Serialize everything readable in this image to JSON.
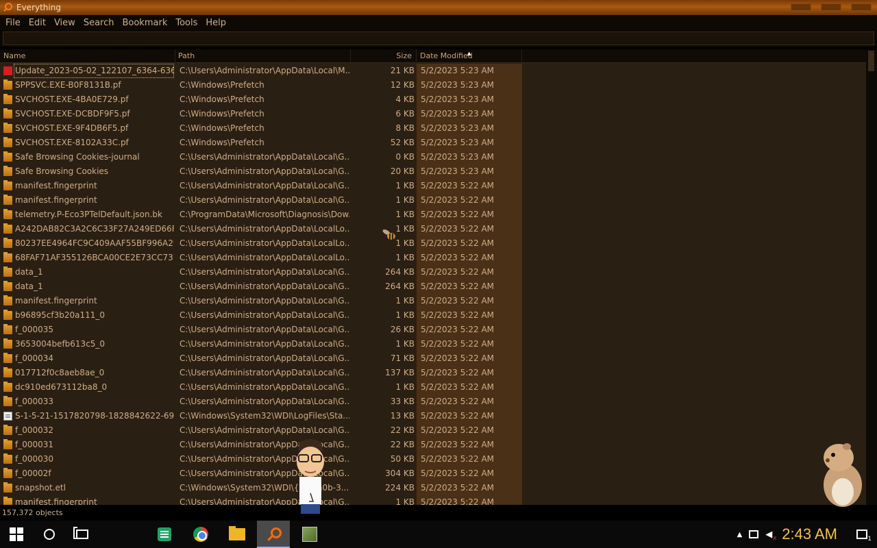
{
  "window": {
    "title": "Everything"
  },
  "menu": [
    "File",
    "Edit",
    "View",
    "Search",
    "Bookmark",
    "Tools",
    "Help"
  ],
  "search": {
    "value": ""
  },
  "columns": {
    "name": "Name",
    "path": "Path",
    "size": "Size",
    "date": "Date Modified",
    "sort_indicator": "▲"
  },
  "rows": [
    {
      "icon": "red-file-icon",
      "name": "Update_2023-05-02_122107_6364-636...",
      "path": "C:\\Users\\Administrator\\AppData\\Local\\M...",
      "size": "21 KB",
      "date": "5/2/2023 5:23 AM",
      "selected": true
    },
    {
      "icon": "folder-icon",
      "name": "SPPSVC.EXE-B0F8131B.pf",
      "path": "C:\\Windows\\Prefetch",
      "size": "12 KB",
      "date": "5/2/2023 5:23 AM"
    },
    {
      "icon": "folder-icon",
      "name": "SVCHOST.EXE-4BA0E729.pf",
      "path": "C:\\Windows\\Prefetch",
      "size": "4 KB",
      "date": "5/2/2023 5:23 AM"
    },
    {
      "icon": "folder-icon",
      "name": "SVCHOST.EXE-DCBDF9F5.pf",
      "path": "C:\\Windows\\Prefetch",
      "size": "6 KB",
      "date": "5/2/2023 5:23 AM"
    },
    {
      "icon": "folder-icon",
      "name": "SVCHOST.EXE-9F4DB6F5.pf",
      "path": "C:\\Windows\\Prefetch",
      "size": "8 KB",
      "date": "5/2/2023 5:23 AM"
    },
    {
      "icon": "folder-icon",
      "name": "SVCHOST.EXE-8102A33C.pf",
      "path": "C:\\Windows\\Prefetch",
      "size": "52 KB",
      "date": "5/2/2023 5:23 AM"
    },
    {
      "icon": "folder-icon",
      "name": "Safe Browsing Cookies-journal",
      "path": "C:\\Users\\Administrator\\AppData\\Local\\G...",
      "size": "0 KB",
      "date": "5/2/2023 5:23 AM"
    },
    {
      "icon": "folder-icon",
      "name": "Safe Browsing Cookies",
      "path": "C:\\Users\\Administrator\\AppData\\Local\\G...",
      "size": "20 KB",
      "date": "5/2/2023 5:23 AM"
    },
    {
      "icon": "folder-icon",
      "name": "manifest.fingerprint",
      "path": "C:\\Users\\Administrator\\AppData\\Local\\G...",
      "size": "1 KB",
      "date": "5/2/2023 5:22 AM"
    },
    {
      "icon": "folder-icon",
      "name": "manifest.fingerprint",
      "path": "C:\\Users\\Administrator\\AppData\\Local\\G...",
      "size": "1 KB",
      "date": "5/2/2023 5:22 AM"
    },
    {
      "icon": "folder-icon",
      "name": "telemetry.P-Eco3PTelDefault.json.bk",
      "path": "C:\\ProgramData\\Microsoft\\Diagnosis\\Dow...",
      "size": "1 KB",
      "date": "5/2/2023 5:22 AM"
    },
    {
      "icon": "folder-icon",
      "name": "A242DAB82C3A2C6C33F27A249ED66F...",
      "path": "C:\\Users\\Administrator\\AppData\\LocalLo...",
      "size": "1 KB",
      "date": "5/2/2023 5:22 AM"
    },
    {
      "icon": "folder-icon",
      "name": "80237EE4964FC9C409AAF55BF996A29...",
      "path": "C:\\Users\\Administrator\\AppData\\LocalLo...",
      "size": "1 KB",
      "date": "5/2/2023 5:22 AM"
    },
    {
      "icon": "folder-icon",
      "name": "68FAF71AF355126BCA00CE2E73CC737...",
      "path": "C:\\Users\\Administrator\\AppData\\LocalLo...",
      "size": "1 KB",
      "date": "5/2/2023 5:22 AM"
    },
    {
      "icon": "folder-icon",
      "name": "data_1",
      "path": "C:\\Users\\Administrator\\AppData\\Local\\G...",
      "size": "264 KB",
      "date": "5/2/2023 5:22 AM"
    },
    {
      "icon": "folder-icon",
      "name": "data_1",
      "path": "C:\\Users\\Administrator\\AppData\\Local\\G...",
      "size": "264 KB",
      "date": "5/2/2023 5:22 AM"
    },
    {
      "icon": "folder-icon",
      "name": "manifest.fingerprint",
      "path": "C:\\Users\\Administrator\\AppData\\Local\\G...",
      "size": "1 KB",
      "date": "5/2/2023 5:22 AM"
    },
    {
      "icon": "folder-icon",
      "name": "b96895cf3b20a111_0",
      "path": "C:\\Users\\Administrator\\AppData\\Local\\G...",
      "size": "1 KB",
      "date": "5/2/2023 5:22 AM"
    },
    {
      "icon": "folder-icon",
      "name": "f_000035",
      "path": "C:\\Users\\Administrator\\AppData\\Local\\G...",
      "size": "26 KB",
      "date": "5/2/2023 5:22 AM"
    },
    {
      "icon": "folder-icon",
      "name": "3653004befb613c5_0",
      "path": "C:\\Users\\Administrator\\AppData\\Local\\G...",
      "size": "1 KB",
      "date": "5/2/2023 5:22 AM"
    },
    {
      "icon": "folder-icon",
      "name": "f_000034",
      "path": "C:\\Users\\Administrator\\AppData\\Local\\G...",
      "size": "71 KB",
      "date": "5/2/2023 5:22 AM"
    },
    {
      "icon": "folder-icon",
      "name": "017712f0c8aeb8ae_0",
      "path": "C:\\Users\\Administrator\\AppData\\Local\\G...",
      "size": "137 KB",
      "date": "5/2/2023 5:22 AM"
    },
    {
      "icon": "folder-icon",
      "name": "dc910ed673112ba8_0",
      "path": "C:\\Users\\Administrator\\AppData\\Local\\G...",
      "size": "1 KB",
      "date": "5/2/2023 5:22 AM"
    },
    {
      "icon": "folder-icon",
      "name": "f_000033",
      "path": "C:\\Users\\Administrator\\AppData\\Local\\G...",
      "size": "33 KB",
      "date": "5/2/2023 5:22 AM"
    },
    {
      "icon": "document-icon",
      "name": "S-1-5-21-1517820798-1828842622-698...",
      "path": "C:\\Windows\\System32\\WDI\\LogFiles\\Sta...",
      "size": "13 KB",
      "date": "5/2/2023 5:22 AM"
    },
    {
      "icon": "folder-icon",
      "name": "f_000032",
      "path": "C:\\Users\\Administrator\\AppData\\Local\\G...",
      "size": "22 KB",
      "date": "5/2/2023 5:22 AM"
    },
    {
      "icon": "folder-icon",
      "name": "f_000031",
      "path": "C:\\Users\\Administrator\\AppData\\Local\\G...",
      "size": "22 KB",
      "date": "5/2/2023 5:22 AM"
    },
    {
      "icon": "folder-icon",
      "name": "f_000030",
      "path": "C:\\Users\\Administrator\\AppData\\Local\\G...",
      "size": "50 KB",
      "date": "5/2/2023 5:22 AM"
    },
    {
      "icon": "folder-icon",
      "name": "f_00002f",
      "path": "C:\\Users\\Administrator\\AppData\\Local\\G...",
      "size": "304 KB",
      "date": "5/2/2023 5:22 AM"
    },
    {
      "icon": "folder-icon",
      "name": "snapshot.etl",
      "path": "C:\\Windows\\System32\\WDI\\{86...a0b-3...",
      "size": "224 KB",
      "date": "5/2/2023 5:22 AM"
    },
    {
      "icon": "folder-icon",
      "name": "manifest.fingerprint",
      "path": "C:\\Users\\Administrator\\AppData\\Local\\G...",
      "size": "1 KB",
      "date": "5/2/2023 5:22 AM"
    }
  ],
  "status": {
    "objects": "157,372 objects"
  },
  "taskbar": {
    "apps": [
      "start-icon",
      "cortana-icon",
      "task-view-icon",
      "sheets-icon",
      "chrome-icon",
      "file-explorer-icon",
      "everything-search-icon",
      "bonzi-icon"
    ],
    "clock": "2:43 AM",
    "notification_count": "1"
  },
  "colors": {
    "title_gradient": "#a85a10",
    "date_column_bg": "#4a3017",
    "list_bg": "#2a1f13",
    "clock": "#f2c14e"
  }
}
